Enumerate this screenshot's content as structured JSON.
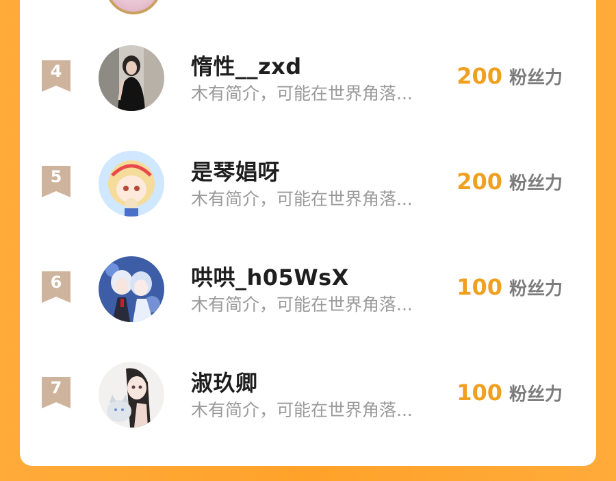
{
  "accent_color": "#f0a020",
  "background_color": "#ffa22a",
  "rows": [
    {
      "rank": "4",
      "name": "惰性__zxd",
      "description": "木有简介，可能在世界角落...",
      "score": "200",
      "unit": "粉丝力",
      "avatar_icon": "avatar-girl-black-dress"
    },
    {
      "rank": "5",
      "name": "是琴娼呀",
      "description": "木有简介，可能在世界角落...",
      "score": "200",
      "unit": "粉丝力",
      "avatar_icon": "avatar-anime-blonde-girl"
    },
    {
      "rank": "6",
      "name": "哄哄_h05WsX",
      "description": "木有简介，可能在世界角落...",
      "score": "100",
      "unit": "粉丝力",
      "avatar_icon": "avatar-anime-couple"
    },
    {
      "rank": "7",
      "name": "淑玖卿",
      "description": "木有简介，可能在世界角落...",
      "score": "100",
      "unit": "粉丝力",
      "avatar_icon": "avatar-anime-girl-with-cat"
    }
  ]
}
